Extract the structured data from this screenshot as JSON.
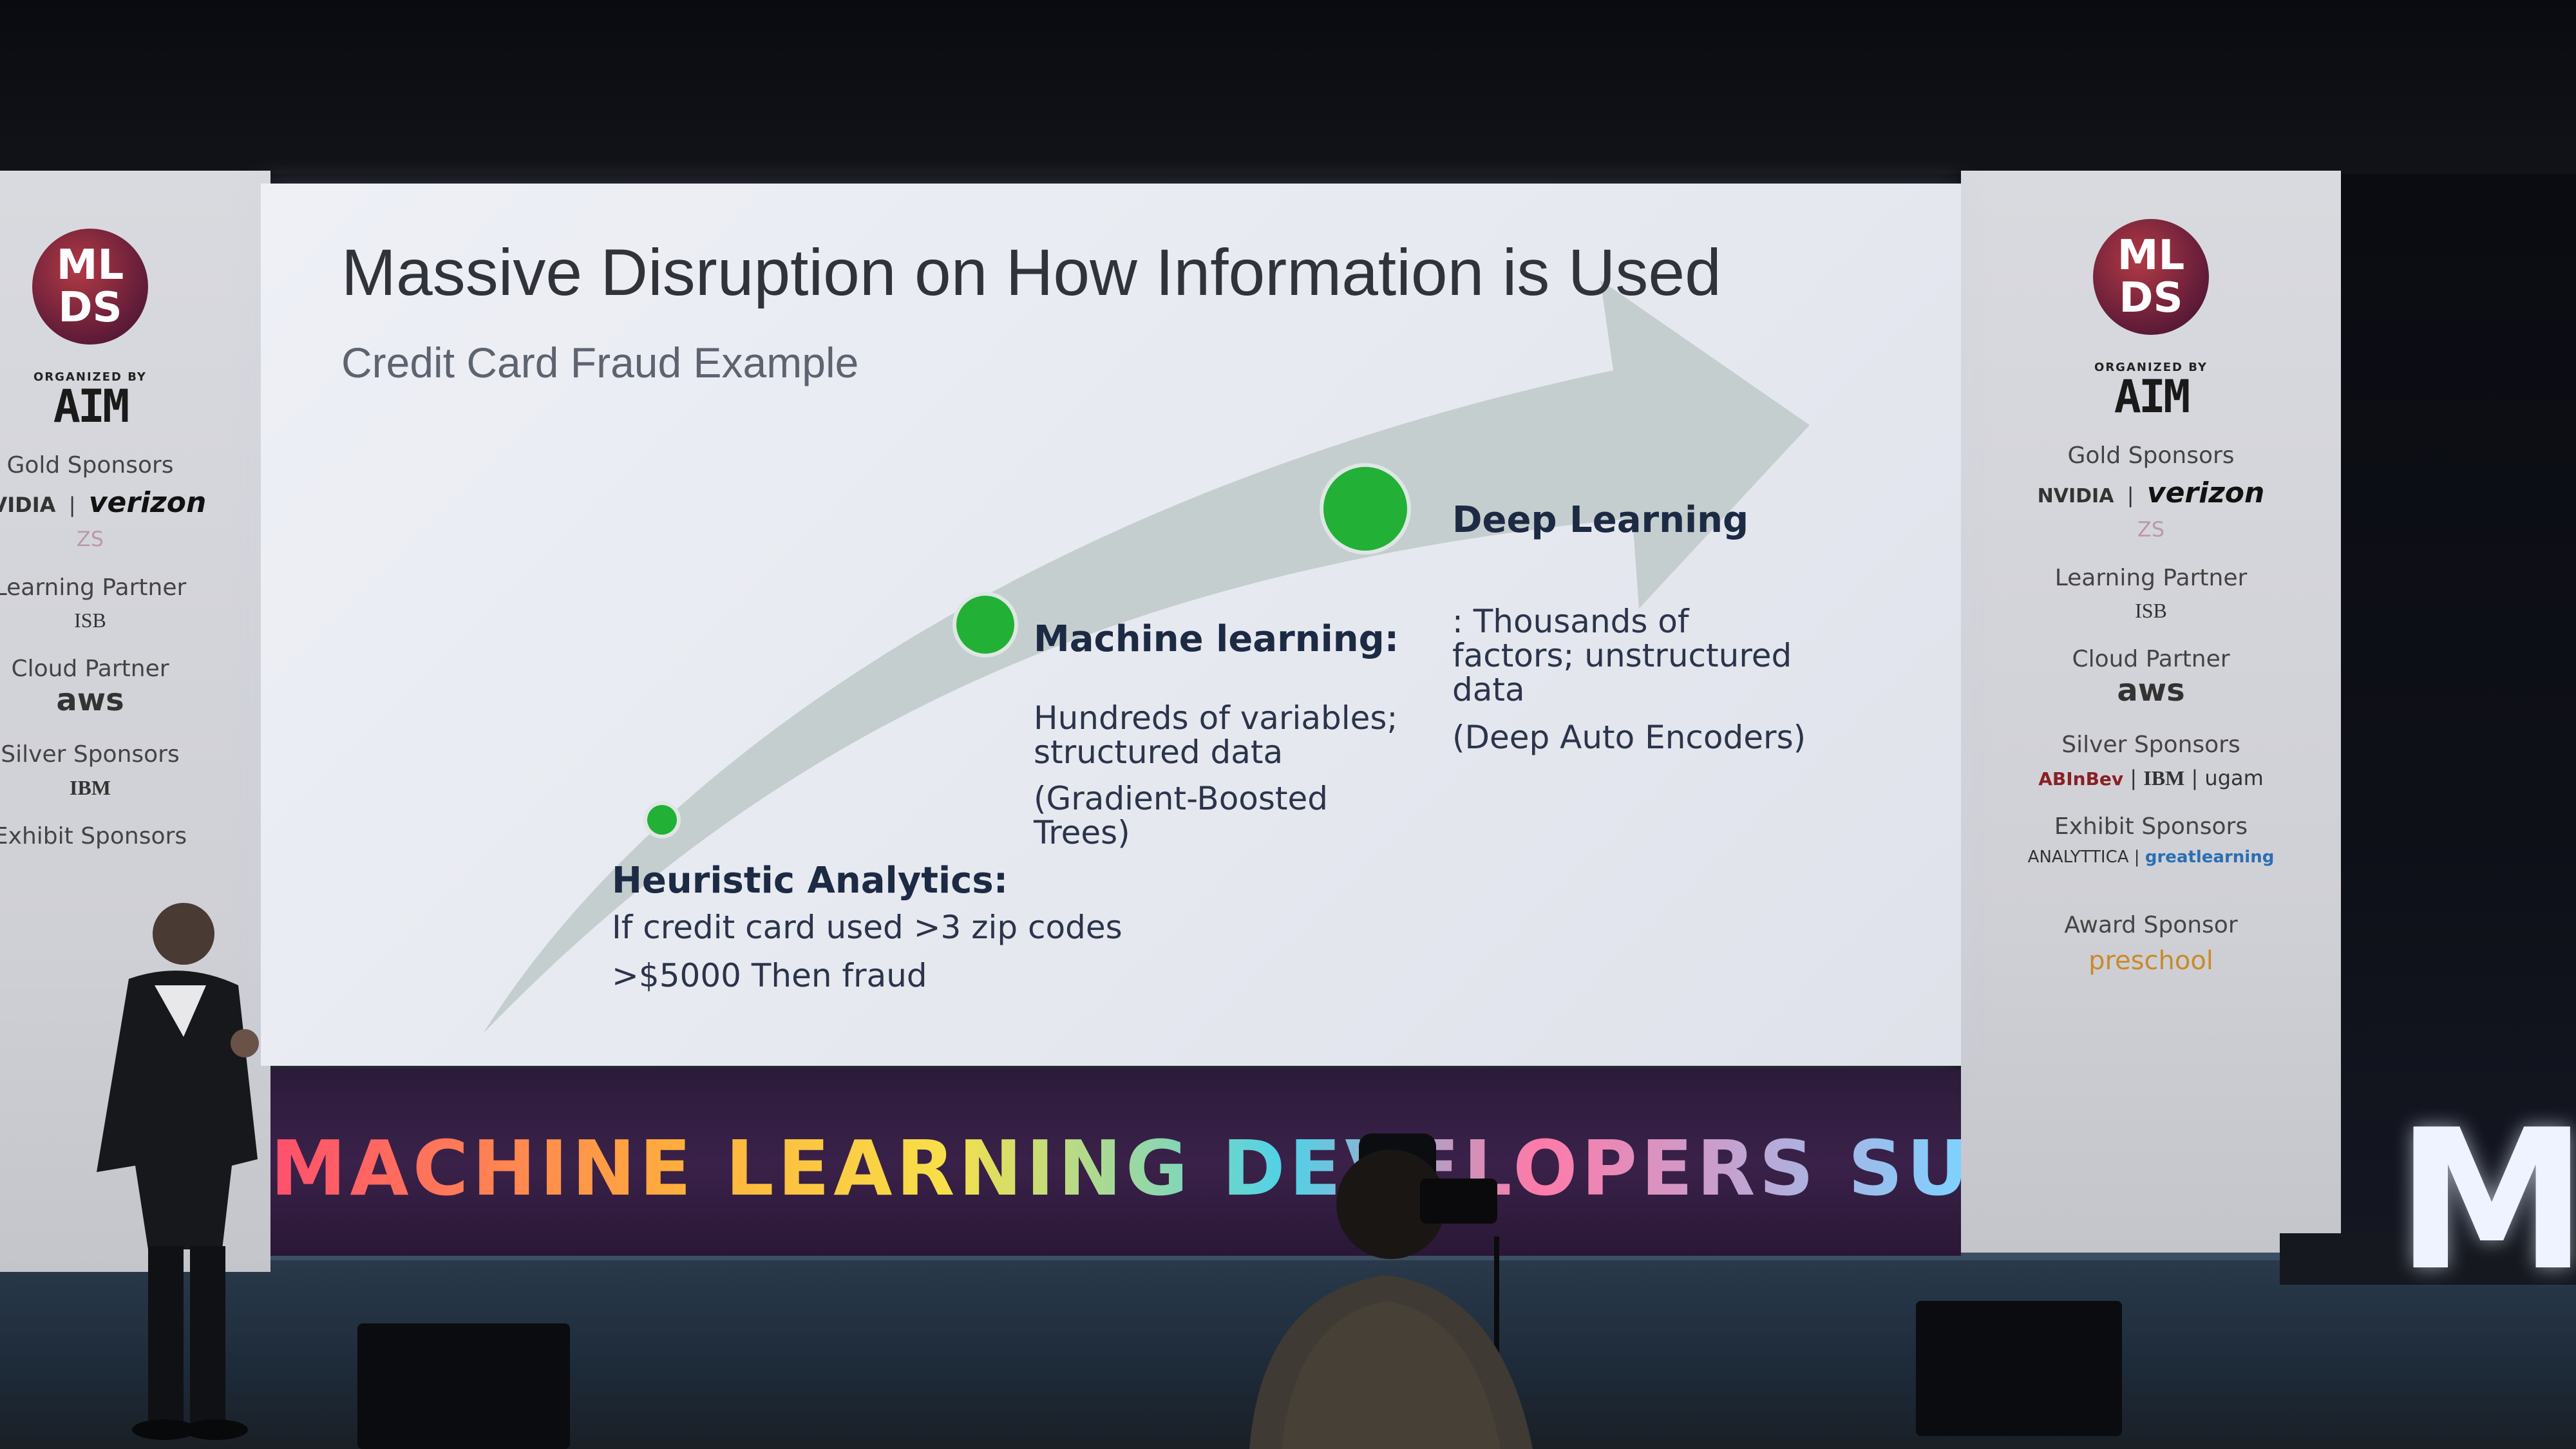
{
  "slide": {
    "title": "Massive Disruption on How Information is Used",
    "subtitle": "Credit Card Fraud Example",
    "stages": [
      {
        "title": "Heuristic Analytics:",
        "lines": [
          "If credit card used >3 zip codes",
          ">$5000  Then fraud"
        ]
      },
      {
        "title": "Machine learning:",
        "lines": [
          "Hundreds of variables;",
          "structured data",
          "(Gradient-Boosted",
          "Trees)"
        ]
      },
      {
        "title": "Deep Learning",
        "lines": [
          ": Thousands of",
          "factors; unstructured",
          "data",
          "(Deep Auto Encoders)"
        ]
      }
    ],
    "colors": {
      "dot": "#22b036",
      "arrow": "#c3cccb",
      "background": "#eceef4"
    }
  },
  "event_banner": {
    "text": "MACHINE LEARNING DEVELOPERS SUMMIT"
  },
  "side_banners": {
    "logo": [
      "ML",
      "DS"
    ],
    "organized_by": "ORGANIZED BY",
    "organizer": "AIM",
    "gold_sponsors_label": "Gold Sponsors",
    "gold_sponsors": [
      "NVIDIA",
      "verizon"
    ],
    "gold_sponsor_extra": "ZS",
    "learning_partner_label": "Learning Partner",
    "learning_partner": "ISB",
    "cloud_partner_label": "Cloud Partner",
    "cloud_partner": "aws",
    "silver_sponsors_label": "Silver Sponsors",
    "silver_sponsors": [
      "ABInBev",
      "IBM",
      "ugam"
    ],
    "exhibit_sponsors_label": "Exhibit Sponsors",
    "exhibit_sponsors": [
      "ANALYTTICA",
      "greatlearning"
    ],
    "award_sponsor_label": "Award Sponsor",
    "award_sponsor": "preschool"
  },
  "stage_sign": {
    "letters": "MI"
  }
}
